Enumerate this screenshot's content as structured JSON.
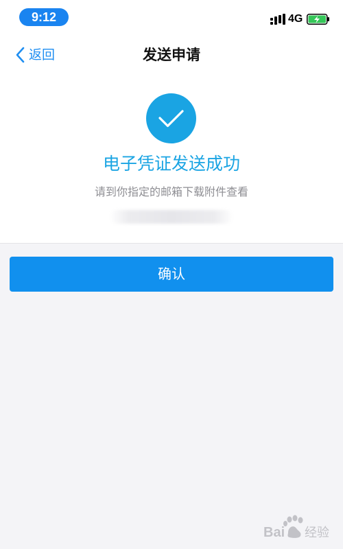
{
  "status_bar": {
    "time": "9:12",
    "network": "4G"
  },
  "nav": {
    "back_label": "返回",
    "title": "发送申请"
  },
  "result": {
    "title": "电子凭证发送成功",
    "hint": "请到你指定的邮箱下载附件查看"
  },
  "actions": {
    "confirm_label": "确认"
  },
  "colors": {
    "accent": "#1190ee",
    "success_circle": "#1aa4e3",
    "battery": "#35c759"
  },
  "watermark": {
    "text": "Bai 经验"
  }
}
